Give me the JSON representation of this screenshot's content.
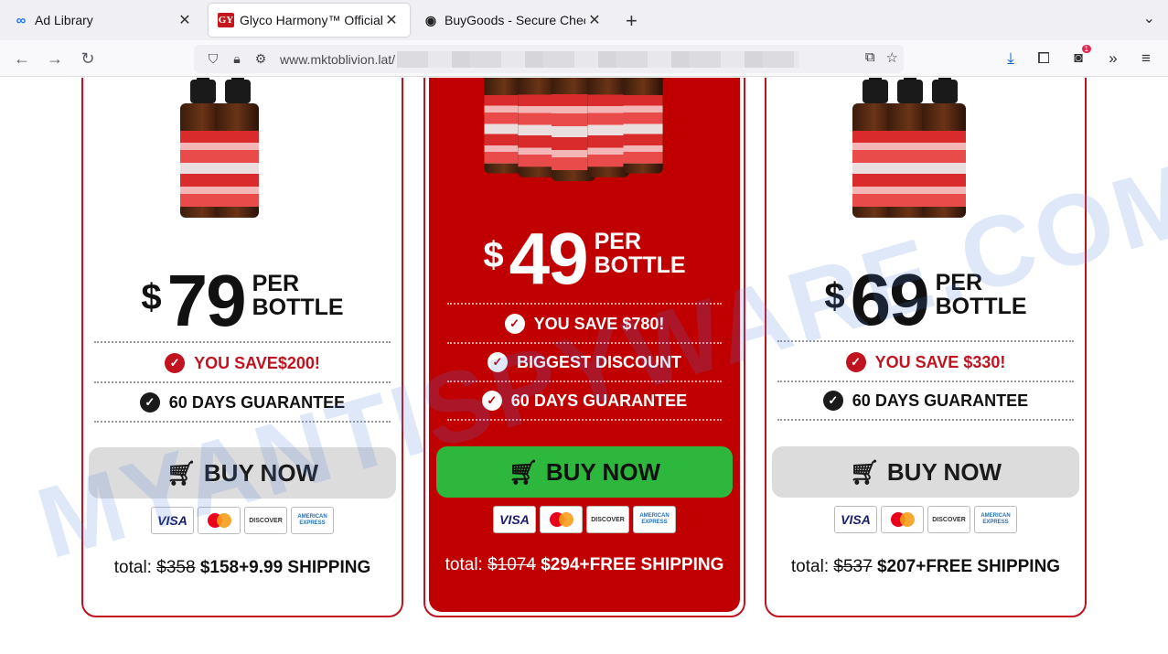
{
  "tabs": [
    {
      "title": "Ad Library",
      "favicon": "meta-icon",
      "active": false
    },
    {
      "title": "Glyco Harmony™ Official",
      "favicon": "gy-icon",
      "active": true
    },
    {
      "title": "BuyGoods - Secure Checko",
      "favicon": "buygoods-icon",
      "active": false
    }
  ],
  "urlbar": {
    "url": "www.mktoblivion.lat/"
  },
  "offers": [
    {
      "currency": "$",
      "price": "79",
      "per_line1": "PER",
      "per_line2": "BOTTLE",
      "feature1": "YOU SAVE$200!",
      "feature2": "60 DAYS GUARANTEE",
      "buy_label": "BUY NOW",
      "total_label": "total:",
      "total_old": "$358",
      "total_new": "$158+9.99 SHIPPING"
    },
    {
      "currency": "$",
      "price": "49",
      "per_line1": "PER",
      "per_line2": "BOTTLE",
      "feature1": "YOU SAVE $780!",
      "feature2": "BIGGEST DISCOUNT",
      "feature3": "60 DAYS GUARANTEE",
      "buy_label": "BUY NOW",
      "total_label": "total:",
      "total_old": "$1074",
      "total_new": "$294+FREE SHIPPING"
    },
    {
      "currency": "$",
      "price": "69",
      "per_line1": "PER",
      "per_line2": "BOTTLE",
      "feature1": "YOU SAVE $330!",
      "feature2": "60 DAYS GUARANTEE",
      "buy_label": "BUY NOW",
      "total_label": "total:",
      "total_old": "$537",
      "total_new": "$207+FREE SHIPPING"
    }
  ],
  "payment_cards": {
    "visa": "VISA",
    "mastercard": "mastercard",
    "discover": "DISCOVER",
    "amex": "AMERICAN EXPRESS"
  },
  "watermark": "MYANTISPYWARE.COM",
  "extension_badge": "1",
  "colors": {
    "accent_red": "#c1121f",
    "popular_bg": "#c00000",
    "buy_green": "#2db83d",
    "buy_gray": "#dcdcdc"
  }
}
